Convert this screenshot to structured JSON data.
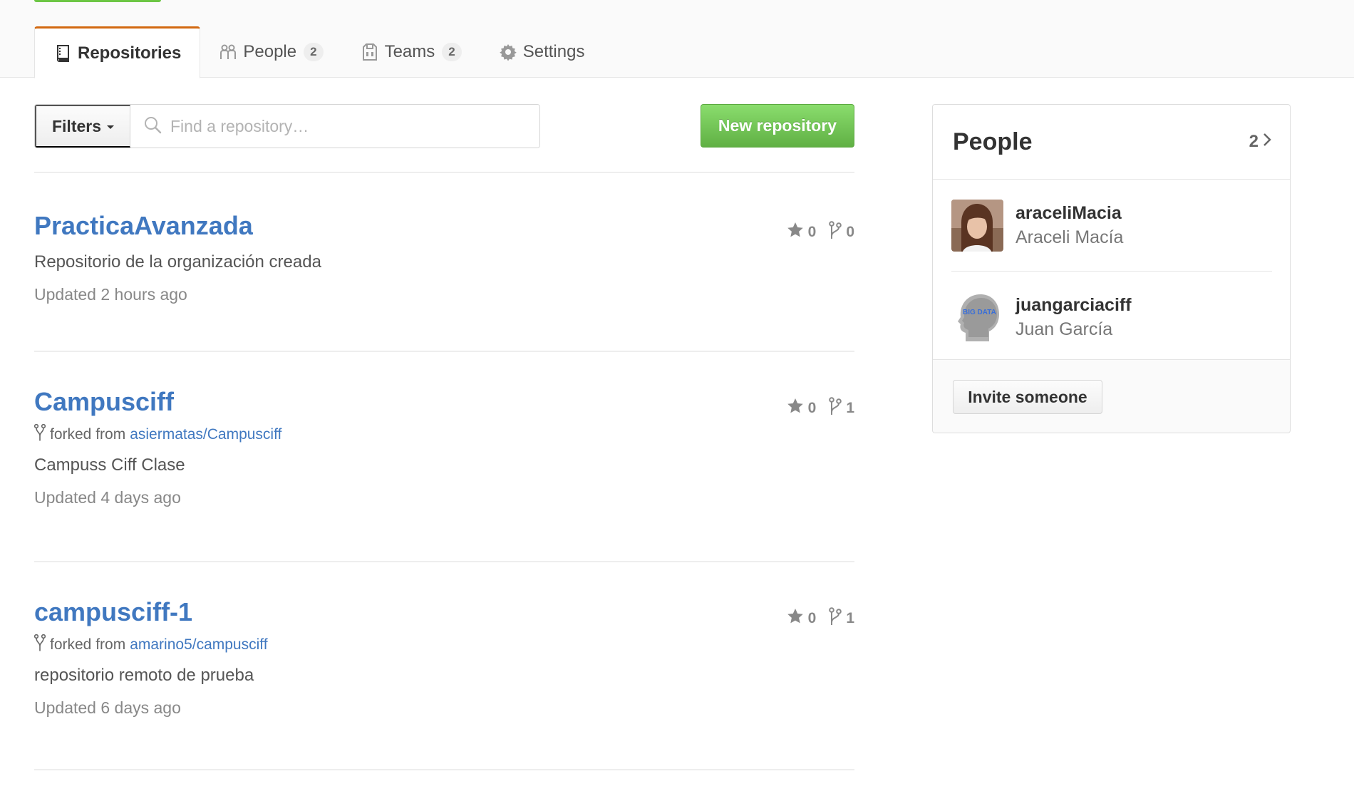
{
  "tabs": [
    {
      "label": "Repositories",
      "icon": "repo-icon",
      "selected": true
    },
    {
      "label": "People",
      "icon": "people-icon",
      "count": "2"
    },
    {
      "label": "Teams",
      "icon": "teams-icon",
      "count": "2"
    },
    {
      "label": "Settings",
      "icon": "gear-icon"
    }
  ],
  "toolbar": {
    "filters_label": "Filters",
    "search_placeholder": "Find a repository…",
    "new_repo_label": "New repository"
  },
  "repos": [
    {
      "name": "PracticaAvanzada",
      "description": "Repositorio de la organización creada",
      "updated": "Updated 2 hours ago",
      "stars": "0",
      "forks": "0"
    },
    {
      "name": "Campusciff",
      "forked_prefix": "forked from",
      "forked_from": "asiermatas/Campusciff",
      "description": "Campuss Ciff Clase",
      "updated": "Updated 4 days ago",
      "stars": "0",
      "forks": "1"
    },
    {
      "name": "campusciff-1",
      "forked_prefix": "forked from",
      "forked_from": "amarino5/campusciff",
      "description": "repositorio remoto de prueba",
      "updated": "Updated 6 days ago",
      "stars": "0",
      "forks": "1"
    }
  ],
  "sidebar": {
    "title": "People",
    "count": "2",
    "members": [
      {
        "login": "araceliMacia",
        "full_name": "Araceli Macía"
      },
      {
        "login": "juangarciaciff",
        "full_name": "Juan García",
        "avatar_text": "BIG DATA"
      }
    ],
    "invite_label": "Invite someone"
  },
  "colors": {
    "link": "#4078c0",
    "accent_tab": "#d26911",
    "primary_button": "#60b044"
  }
}
